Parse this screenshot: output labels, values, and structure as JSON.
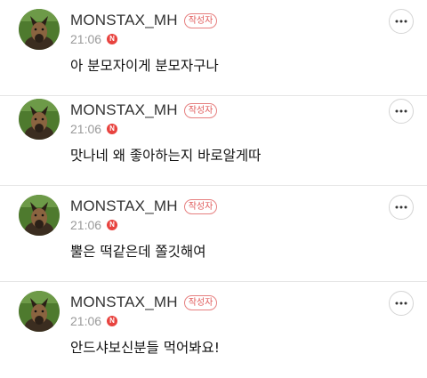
{
  "comments": [
    {
      "author": "MONSTAX_MH",
      "author_badge": "작성자",
      "time": "21:06",
      "new_badge": "N",
      "text": "아 분모자이게 분모자구나"
    },
    {
      "author": "MONSTAX_MH",
      "author_badge": "작성자",
      "time": "21:06",
      "new_badge": "N",
      "text": "맛나네 왜 좋아하는지 바로알게따"
    },
    {
      "author": "MONSTAX_MH",
      "author_badge": "작성자",
      "time": "21:06",
      "new_badge": "N",
      "text": "뿔은 떡같은데 쫄깃해여"
    },
    {
      "author": "MONSTAX_MH",
      "author_badge": "작성자",
      "time": "21:06",
      "new_badge": "N",
      "text": "안드샤보신분들 먹어봐요!"
    }
  ],
  "icons": {
    "more": "more-horizontal-icon",
    "avatar": "dog-profile-image"
  },
  "colors": {
    "badge_border": "#e67f7f",
    "badge_text": "#e05a5a",
    "new_badge": "#e8433f",
    "timestamp": "#9a9a9a",
    "divider": "#e6e6e6"
  }
}
